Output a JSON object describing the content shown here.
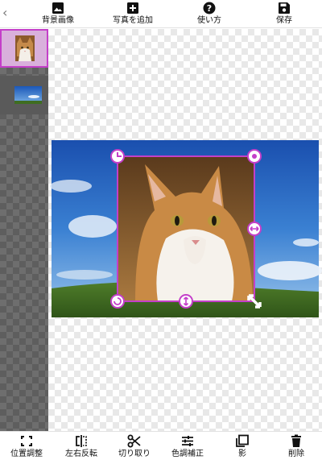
{
  "toolbar": {
    "back_icon": "chevron-left-icon",
    "items": [
      {
        "label": "背景画像",
        "icon": "image-icon"
      },
      {
        "label": "写真を追加",
        "icon": "add-box-icon"
      },
      {
        "label": "使い方",
        "icon": "help-circle-icon"
      },
      {
        "label": "保存",
        "icon": "floppy-disk-icon"
      }
    ]
  },
  "layers": [
    {
      "name": "cat-photo",
      "selected": true
    },
    {
      "name": "sky-background",
      "selected": false
    }
  ],
  "bottom_toolbar": {
    "items": [
      {
        "label": "位置調整",
        "icon": "fit-screen-icon"
      },
      {
        "label": "左右反転",
        "icon": "flip-horizontal-icon"
      },
      {
        "label": "切り取り",
        "icon": "scissors-icon"
      },
      {
        "label": "色調補正",
        "icon": "tune-sliders-icon"
      },
      {
        "label": "影",
        "icon": "shadow-copy-icon"
      },
      {
        "label": "削除",
        "icon": "trash-icon"
      }
    ]
  },
  "colors": {
    "accent": "#c43fc9",
    "handle_fill": "#ffffff",
    "sky_top": "#1f5fbf",
    "grass": "#3f6d22"
  }
}
